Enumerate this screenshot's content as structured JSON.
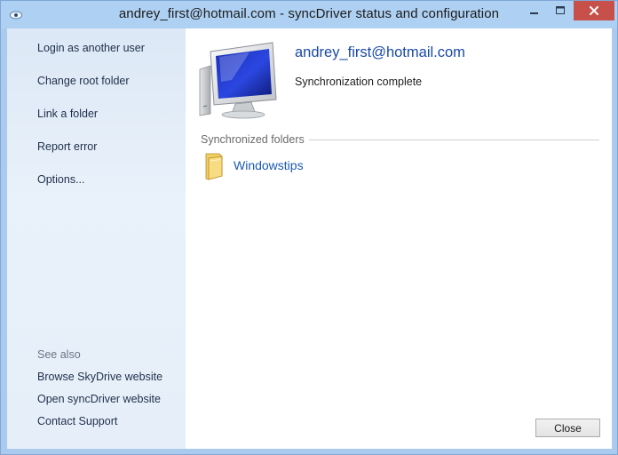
{
  "window": {
    "title": "andrey_first@hotmail.com - syncDriver status and configuration",
    "controls": {
      "minimize_icon": "minimize-icon",
      "maximize_icon": "maximize-icon",
      "close_icon": "close-icon"
    }
  },
  "sidebar": {
    "actions": [
      {
        "label": "Login as another user"
      },
      {
        "label": "Change root folder"
      },
      {
        "label": "Link a folder"
      },
      {
        "label": "Report error"
      },
      {
        "label": "Options..."
      }
    ],
    "see_also": {
      "heading": "See also",
      "links": [
        {
          "label": "Browse SkyDrive website"
        },
        {
          "label": "Open syncDriver website"
        },
        {
          "label": "Contact Support"
        }
      ]
    }
  },
  "main": {
    "account_email": "andrey_first@hotmail.com",
    "status": "Synchronization complete",
    "synced_section": {
      "heading": "Synchronized folders",
      "folders": [
        {
          "name": "Windowstips",
          "icon": "folder-icon"
        }
      ]
    },
    "close_label": "Close"
  },
  "colors": {
    "titlebar": "#aed0f2",
    "close_button_red": "#c7504a",
    "link_blue": "#1a5ab0",
    "email_blue": "#1a4aa6",
    "sidebar_bg": "#e6eff9"
  }
}
